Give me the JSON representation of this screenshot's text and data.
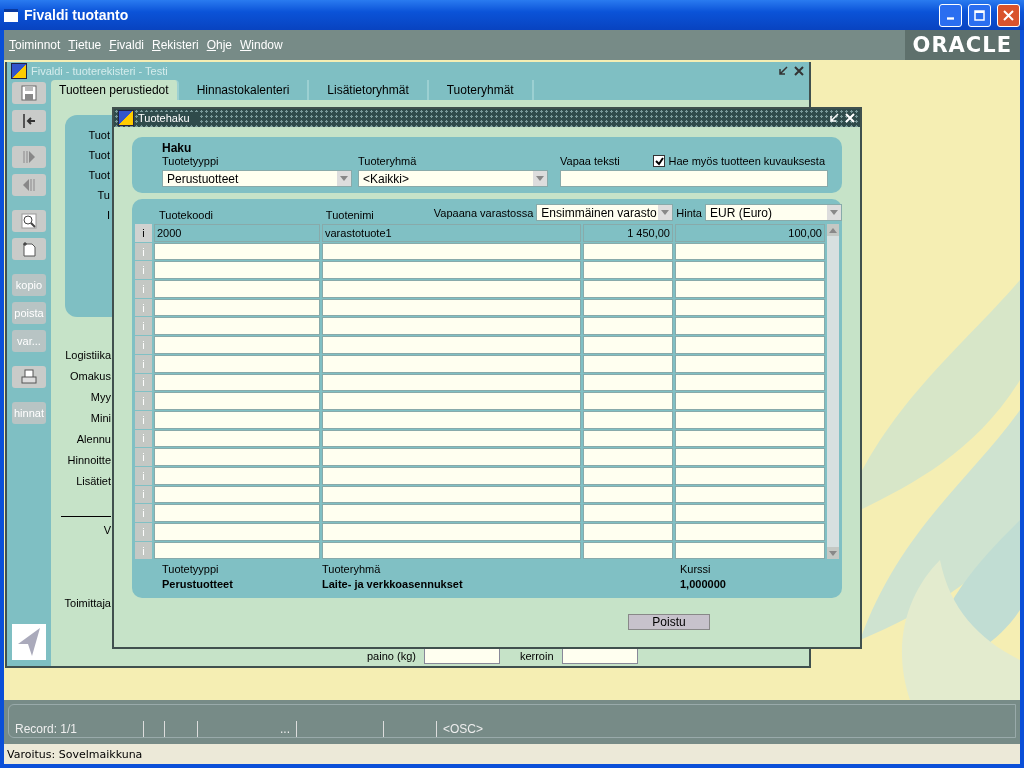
{
  "window": {
    "title": "Fivaldi tuotanto"
  },
  "menu": [
    "Toiminnot",
    "Tietue",
    "Fivaldi",
    "Rekisteri",
    "Ohje",
    "Window"
  ],
  "logo": "ORACLE",
  "form_window": {
    "title": "Fivaldi - tuoterekisteri - Testi",
    "active": false,
    "toolbar": [
      {
        "kind": "icon"
      },
      {
        "kind": "icon"
      },
      {
        "kind": "icon"
      },
      {
        "kind": "icon"
      },
      {
        "kind": "icon"
      },
      {
        "kind": "icon"
      },
      {
        "kind": "text",
        "label": "kopio",
        "disabled": true
      },
      {
        "kind": "text",
        "label": "poista",
        "disabled": true
      },
      {
        "kind": "text",
        "label": "var...",
        "disabled": true
      },
      {
        "kind": "icon"
      },
      {
        "kind": "text",
        "label": "hinnat",
        "disabled": true
      }
    ],
    "tabs": [
      {
        "label": "Tuotteen perustiedot",
        "selected": true
      },
      {
        "label": "Hinnastokalenteri",
        "selected": false
      },
      {
        "label": "Lisätietoryhmät",
        "selected": false
      },
      {
        "label": "Tuoteryhmät",
        "selected": false
      }
    ],
    "panel_labels": [
      "Tuot",
      "Tuot",
      "Tuot",
      "Tu",
      "I"
    ],
    "label_groups": [
      [
        "Logistiika",
        "Omakus",
        "Myy",
        "Mini",
        "Alennu",
        "Hinnoitte",
        "Lisätiet"
      ],
      [
        "V",
        "Toimittaja"
      ]
    ],
    "bottom_fields": [
      {
        "label": "paino (kg)"
      },
      {
        "label": "kerroin"
      }
    ]
  },
  "dialog": {
    "title": "Tuotehaku",
    "search": {
      "heading": "Haku",
      "product_type": {
        "label": "Tuotetyyppi",
        "value": "Perustuotteet"
      },
      "product_group": {
        "label": "Tuoteryhmä",
        "value": "<Kaikki>"
      },
      "free_text": {
        "label": "Vapaa teksti"
      },
      "include_description": {
        "label": "Hae myös tuotteen kuvauksesta",
        "checked": true
      }
    },
    "table": {
      "columns": [
        "Tuotekoodi",
        "Tuotenimi"
      ],
      "stock": {
        "label": "Vapaana varastossa",
        "value": "Ensimmäinen varasto"
      },
      "price": {
        "label": "Hinta",
        "value": "EUR (Euro)"
      },
      "rows": [
        {
          "selected": true,
          "button": "i",
          "cells": [
            "2000",
            "varastotuote1",
            "1 450,00",
            "100,00"
          ]
        },
        {
          "selected": false,
          "button": "i"
        },
        {
          "selected": false,
          "button": "i"
        },
        {
          "selected": false,
          "button": "i"
        },
        {
          "selected": false,
          "button": "i"
        },
        {
          "selected": false,
          "button": "i"
        },
        {
          "selected": false,
          "button": "i"
        },
        {
          "selected": false,
          "button": "i"
        },
        {
          "selected": false,
          "button": "i"
        },
        {
          "selected": false,
          "button": "i"
        },
        {
          "selected": false,
          "button": "i"
        },
        {
          "selected": false,
          "button": "i"
        },
        {
          "selected": false,
          "button": "i"
        },
        {
          "selected": false,
          "button": "i"
        },
        {
          "selected": false,
          "button": "i"
        },
        {
          "selected": false,
          "button": "i"
        },
        {
          "selected": false,
          "button": "i"
        },
        {
          "selected": false,
          "button": "i"
        }
      ]
    },
    "details": [
      {
        "label": "Tuotetyyppi",
        "value": "Perustuotteet"
      },
      {
        "label": "Tuoteryhmä",
        "value": "Laite- ja verkkoasennukset"
      },
      {
        "label": "Kurssi",
        "value": "1,000000"
      }
    ],
    "button": "Poistu"
  },
  "status_bar": {
    "record": "Record: 1/1",
    "cells": [
      "",
      "",
      "...",
      "",
      "",
      "<OSC>"
    ]
  },
  "message": "Varoitus: Sovelmaikkuna"
}
